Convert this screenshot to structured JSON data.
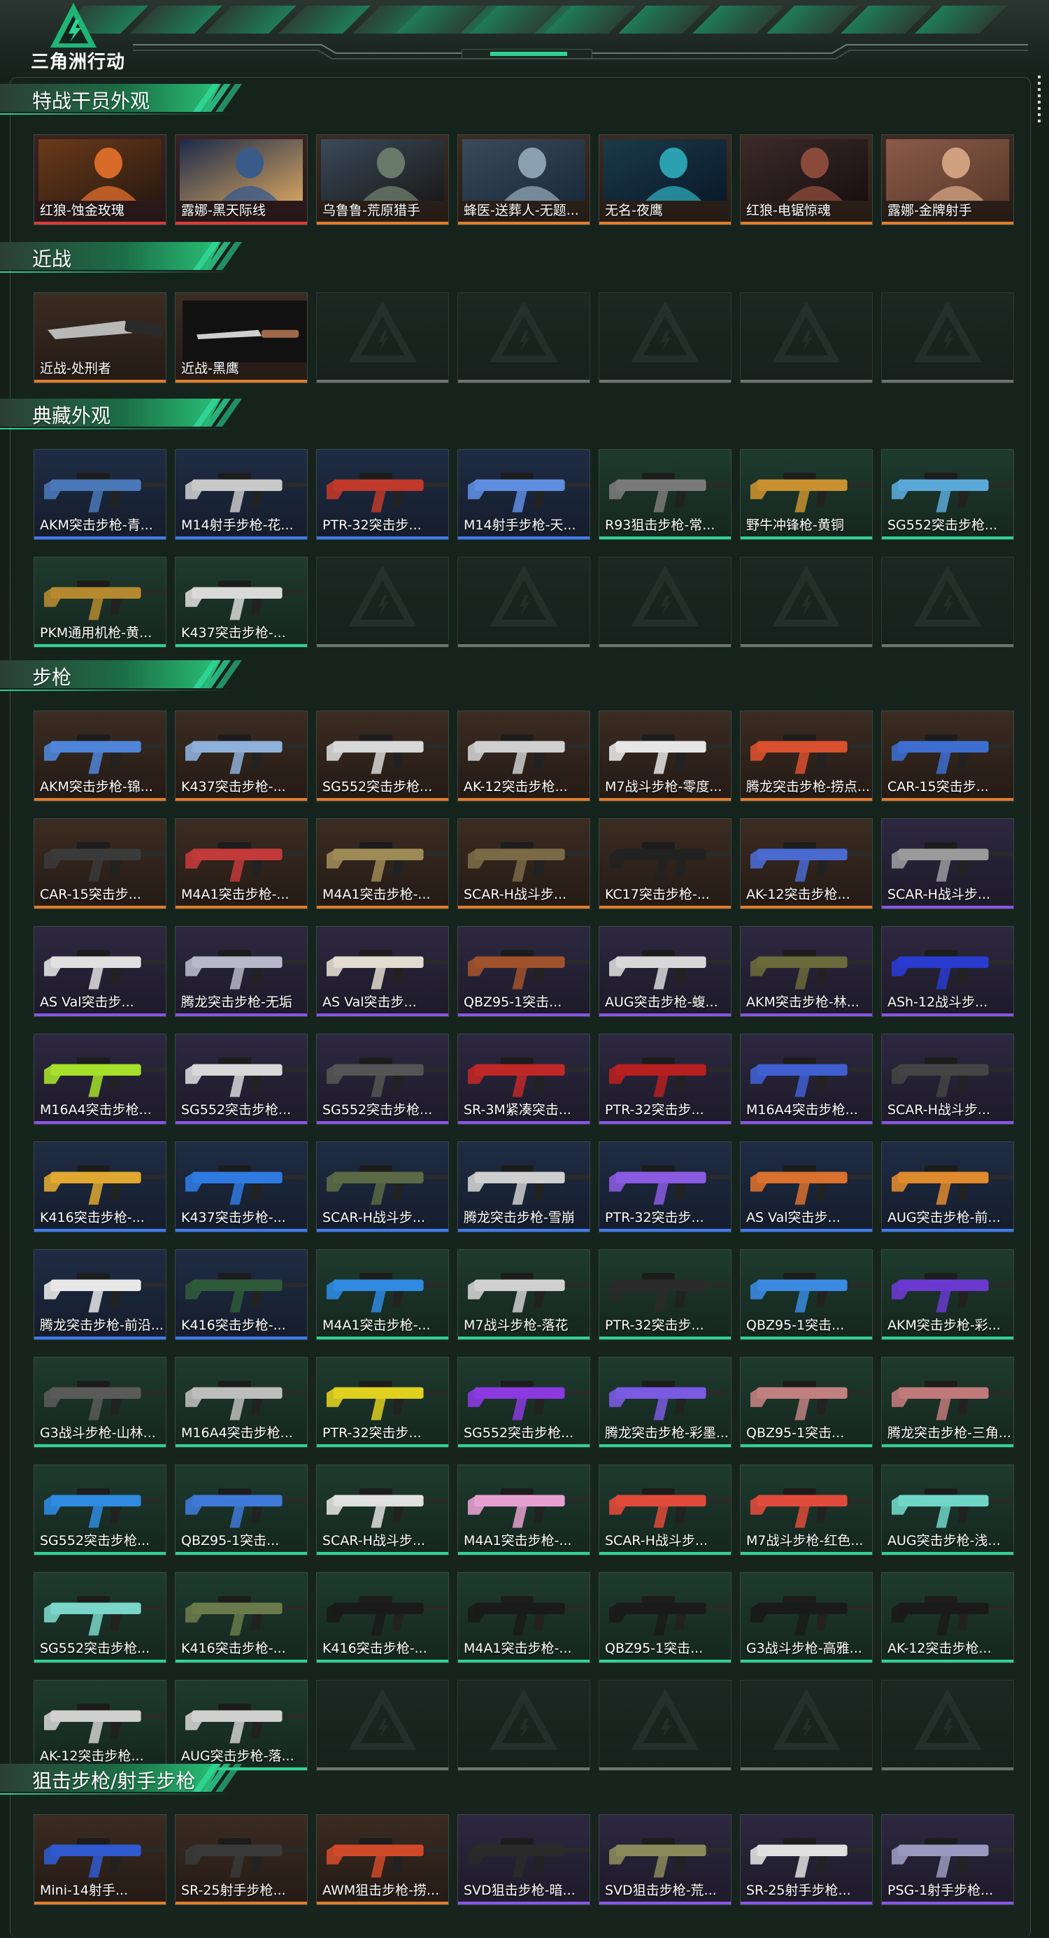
{
  "header": {
    "logo_text": "三角洲行动",
    "colors": {
      "accent": "#2fd394",
      "background": "#152019"
    }
  },
  "sections": [
    {
      "title": "特战干员外观",
      "items": [
        {
          "label": "红狼-蚀金玫瑰",
          "rarity": "red",
          "icon": "operator-portrait"
        },
        {
          "label": "露娜-黑天际线",
          "rarity": "red",
          "icon": "operator-portrait"
        },
        {
          "label": "乌鲁鲁-荒原猎手",
          "rarity": "orange",
          "icon": "operator-portrait"
        },
        {
          "label": "蜂医-送葬人-无题...",
          "rarity": "orange",
          "icon": "operator-portrait"
        },
        {
          "label": "无名-夜鹰",
          "rarity": "orange",
          "icon": "operator-portrait"
        },
        {
          "label": "红狼-电锯惊魂",
          "rarity": "orange",
          "icon": "operator-portrait"
        },
        {
          "label": "露娜-金牌射手",
          "rarity": "orange",
          "icon": "operator-portrait"
        }
      ]
    },
    {
      "title": "近战",
      "items": [
        {
          "label": "近战-处刑者",
          "rarity": "orange",
          "icon": "knife"
        },
        {
          "label": "近战-黑鹰",
          "rarity": "orange",
          "icon": "knife"
        },
        {
          "label": "",
          "rarity": "empty",
          "icon": "empty-slot"
        },
        {
          "label": "",
          "rarity": "empty",
          "icon": "empty-slot"
        },
        {
          "label": "",
          "rarity": "empty",
          "icon": "empty-slot"
        },
        {
          "label": "",
          "rarity": "empty",
          "icon": "empty-slot"
        },
        {
          "label": "",
          "rarity": "empty",
          "icon": "empty-slot"
        }
      ]
    },
    {
      "title": "典藏外观",
      "items": [
        {
          "label": "AKM突击步枪-青...",
          "rarity": "blue",
          "icon": "gun",
          "gun_color": "#4a78b8"
        },
        {
          "label": "M14射手步枪-花...",
          "rarity": "blue",
          "icon": "gun",
          "gun_color": "#c9c9c9"
        },
        {
          "label": "PTR-32突击步...",
          "rarity": "blue",
          "icon": "gun",
          "gun_color": "#c0392b"
        },
        {
          "label": "M14射手步枪-天...",
          "rarity": "blue",
          "icon": "gun",
          "gun_color": "#5f8de0"
        },
        {
          "label": "R93狙击步枪-常...",
          "rarity": "green",
          "icon": "gun",
          "gun_color": "#7a7a7a"
        },
        {
          "label": "野牛冲锋枪-黄铜",
          "rarity": "green",
          "icon": "gun",
          "gun_color": "#c8902e"
        },
        {
          "label": "SG552突击步枪...",
          "rarity": "green",
          "icon": "gun",
          "gun_color": "#5aa8d8"
        },
        {
          "label": "PKM通用机枪-黄...",
          "rarity": "green",
          "icon": "gun",
          "gun_color": "#b5892f"
        },
        {
          "label": "K437突击步枪-...",
          "rarity": "green",
          "icon": "gun",
          "gun_color": "#d9d9d9"
        },
        {
          "label": "",
          "rarity": "empty",
          "icon": "empty-slot"
        },
        {
          "label": "",
          "rarity": "empty",
          "icon": "empty-slot"
        },
        {
          "label": "",
          "rarity": "empty",
          "icon": "empty-slot"
        },
        {
          "label": "",
          "rarity": "empty",
          "icon": "empty-slot"
        },
        {
          "label": "",
          "rarity": "empty",
          "icon": "empty-slot"
        }
      ]
    },
    {
      "title": "步枪",
      "items": [
        {
          "label": "AKM突击步枪-锦...",
          "rarity": "orange",
          "icon": "gun",
          "gun_color": "#4f86d9"
        },
        {
          "label": "K437突击步枪-...",
          "rarity": "orange",
          "icon": "gun",
          "gun_color": "#8fb0d9"
        },
        {
          "label": "SG552突击步枪...",
          "rarity": "orange",
          "icon": "gun",
          "gun_color": "#d8d8d8"
        },
        {
          "label": "AK-12突击步枪...",
          "rarity": "orange",
          "icon": "gun",
          "gun_color": "#cfcfcf"
        },
        {
          "label": "M7战斗步枪-零度...",
          "rarity": "orange",
          "icon": "gun",
          "gun_color": "#e6e6e6"
        },
        {
          "label": "腾龙突击步枪-捞点...",
          "rarity": "orange",
          "icon": "gun",
          "gun_color": "#d9502e"
        },
        {
          "label": "CAR-15突击步...",
          "rarity": "orange",
          "icon": "gun",
          "gun_color": "#3d6ed0"
        },
        {
          "label": "CAR-15突击步...",
          "rarity": "orange",
          "icon": "gun",
          "gun_color": "#3a3a3a"
        },
        {
          "label": "M4A1突击步枪-...",
          "rarity": "orange",
          "icon": "gun",
          "gun_color": "#c23a3a"
        },
        {
          "label": "M4A1突击步枪-...",
          "rarity": "orange",
          "icon": "gun",
          "gun_color": "#9d8a55"
        },
        {
          "label": "SCAR-H战斗步...",
          "rarity": "orange",
          "icon": "gun",
          "gun_color": "#7a6a45"
        },
        {
          "label": "KC17突击步枪-...",
          "rarity": "orange",
          "icon": "gun",
          "gun_color": "#222222"
        },
        {
          "label": "AK-12突击步枪...",
          "rarity": "orange",
          "icon": "gun",
          "gun_color": "#4a6ad0"
        },
        {
          "label": "SCAR-H战斗步...",
          "rarity": "purple",
          "icon": "gun",
          "gun_color": "#9a9a9a"
        },
        {
          "label": "AS Val突击步...",
          "rarity": "purple",
          "icon": "gun",
          "gun_color": "#e0e0e0"
        },
        {
          "label": "腾龙突击步枪-无垢",
          "rarity": "purple",
          "icon": "gun",
          "gun_color": "#b8b8c8"
        },
        {
          "label": "AS Val突击步...",
          "rarity": "purple",
          "icon": "gun",
          "gun_color": "#e3dcd0"
        },
        {
          "label": "QBZ95-1突击...",
          "rarity": "purple",
          "icon": "gun",
          "gun_color": "#a0522d"
        },
        {
          "label": "AUG突击步枪-蝮...",
          "rarity": "purple",
          "icon": "gun",
          "gun_color": "#d8d8d8"
        },
        {
          "label": "AKM突击步枪-林...",
          "rarity": "purple",
          "icon": "gun",
          "gun_color": "#6a6a3a"
        },
        {
          "label": "ASh-12战斗步...",
          "rarity": "purple",
          "icon": "gun",
          "gun_color": "#2a3bd0"
        },
        {
          "label": "M16A4突击步枪...",
          "rarity": "purple",
          "icon": "gun",
          "gun_color": "#a6e02a"
        },
        {
          "label": "SG552突击步枪...",
          "rarity": "purple",
          "icon": "gun",
          "gun_color": "#d8d8d8"
        },
        {
          "label": "SG552突击步枪...",
          "rarity": "purple",
          "icon": "gun",
          "gun_color": "#555555"
        },
        {
          "label": "SR-3M紧凑突击...",
          "rarity": "purple",
          "icon": "gun",
          "gun_color": "#c02828"
        },
        {
          "label": "PTR-32突击步...",
          "rarity": "purple",
          "icon": "gun",
          "gun_color": "#b52020"
        },
        {
          "label": "M16A4突击步枪...",
          "rarity": "purple",
          "icon": "gun",
          "gun_color": "#3f5fd0"
        },
        {
          "label": "SCAR-H战斗步...",
          "rarity": "purple",
          "icon": "gun",
          "gun_color": "#444444"
        },
        {
          "label": "K416突击步枪-...",
          "rarity": "blue",
          "icon": "gun",
          "gun_color": "#e0a830"
        },
        {
          "label": "K437突击步枪-...",
          "rarity": "blue",
          "icon": "gun",
          "gun_color": "#2f7ae0"
        },
        {
          "label": "SCAR-H战斗步...",
          "rarity": "blue",
          "icon": "gun",
          "gun_color": "#5a6a45"
        },
        {
          "label": "腾龙突击步枪-雪崩",
          "rarity": "blue",
          "icon": "gun",
          "gun_color": "#cfcfcf"
        },
        {
          "label": "PTR-32突击步...",
          "rarity": "blue",
          "icon": "gun",
          "gun_color": "#8a5ae0"
        },
        {
          "label": "AS Val突击步...",
          "rarity": "blue",
          "icon": "gun",
          "gun_color": "#d9702e"
        },
        {
          "label": "AUG突击步枪-前...",
          "rarity": "blue",
          "icon": "gun",
          "gun_color": "#e08a2e"
        },
        {
          "label": "腾龙突击步枪-前沿...",
          "rarity": "blue",
          "icon": "gun",
          "gun_color": "#e8e8e8"
        },
        {
          "label": "K416突击步枪-...",
          "rarity": "blue",
          "icon": "gun",
          "gun_color": "#2e5a3a"
        },
        {
          "label": "M4A1突击步枪-...",
          "rarity": "green",
          "icon": "gun",
          "gun_color": "#2f8ae0"
        },
        {
          "label": "M7战斗步枪-落花",
          "rarity": "green",
          "icon": "gun",
          "gun_color": "#d0d0d0"
        },
        {
          "label": "PTR-32突击步...",
          "rarity": "green",
          "icon": "gun",
          "gun_color": "#2a2a2a"
        },
        {
          "label": "QBZ95-1突击...",
          "rarity": "green",
          "icon": "gun",
          "gun_color": "#3a8ae0"
        },
        {
          "label": "AKM突击步枪-彩...",
          "rarity": "green",
          "icon": "gun",
          "gun_color": "#6a3ad0"
        },
        {
          "label": "G3战斗步枪-山林...",
          "rarity": "green",
          "icon": "gun",
          "gun_color": "#5a5a5a"
        },
        {
          "label": "M16A4突击步枪...",
          "rarity": "green",
          "icon": "gun",
          "gun_color": "#bdbdbd"
        },
        {
          "label": "PTR-32突击步...",
          "rarity": "green",
          "icon": "gun",
          "gun_color": "#e0d020"
        },
        {
          "label": "SG552突击步枪...",
          "rarity": "green",
          "icon": "gun",
          "gun_color": "#8a3ae0"
        },
        {
          "label": "腾龙突击步枪-彩墨...",
          "rarity": "green",
          "icon": "gun",
          "gun_color": "#7a5ae0"
        },
        {
          "label": "QBZ95-1突击...",
          "rarity": "green",
          "icon": "gun",
          "gun_color": "#c08080"
        },
        {
          "label": "腾龙突击步枪-三角...",
          "rarity": "green",
          "icon": "gun",
          "gun_color": "#c07a7a"
        },
        {
          "label": "SG552突击步枪...",
          "rarity": "green",
          "icon": "gun",
          "gun_color": "#2f8ae0"
        },
        {
          "label": "QBZ95-1突击...",
          "rarity": "green",
          "icon": "gun",
          "gun_color": "#3f7ad8"
        },
        {
          "label": "SCAR-H战斗步...",
          "rarity": "green",
          "icon": "gun",
          "gun_color": "#e0e0e0"
        },
        {
          "label": "M4A1突击步枪-...",
          "rarity": "green",
          "icon": "gun",
          "gun_color": "#e6a0d0"
        },
        {
          "label": "SCAR-H战斗步...",
          "rarity": "green",
          "icon": "gun",
          "gun_color": "#e04a3a"
        },
        {
          "label": "M7战斗步枪-红色...",
          "rarity": "green",
          "icon": "gun",
          "gun_color": "#e04a3a"
        },
        {
          "label": "AUG突击步枪-浅...",
          "rarity": "green",
          "icon": "gun",
          "gun_color": "#6fd6c8"
        },
        {
          "label": "SG552突击步枪...",
          "rarity": "green",
          "icon": "gun",
          "gun_color": "#7ad6c8"
        },
        {
          "label": "K416突击步枪-...",
          "rarity": "green",
          "icon": "gun",
          "gun_color": "#6a7a4a"
        },
        {
          "label": "K416突击步枪-...",
          "rarity": "green",
          "icon": "gun",
          "gun_color": "#1a1a1a"
        },
        {
          "label": "M4A1突击步枪-...",
          "rarity": "green",
          "icon": "gun",
          "gun_color": "#1a1a1a"
        },
        {
          "label": "QBZ95-1突击...",
          "rarity": "green",
          "icon": "gun",
          "gun_color": "#1a1a1a"
        },
        {
          "label": "G3战斗步枪-高雅...",
          "rarity": "green",
          "icon": "gun",
          "gun_color": "#1a1a1a"
        },
        {
          "label": "AK-12突击步枪...",
          "rarity": "green",
          "icon": "gun",
          "gun_color": "#1a1a1a"
        },
        {
          "label": "AK-12突击步枪...",
          "rarity": "green",
          "icon": "gun",
          "gun_color": "#d0d0d0"
        },
        {
          "label": "AUG突击步枪-落...",
          "rarity": "green",
          "icon": "gun",
          "gun_color": "#d0d0d0"
        },
        {
          "label": "",
          "rarity": "empty",
          "icon": "empty-slot"
        },
        {
          "label": "",
          "rarity": "empty",
          "icon": "empty-slot"
        },
        {
          "label": "",
          "rarity": "empty",
          "icon": "empty-slot"
        },
        {
          "label": "",
          "rarity": "empty",
          "icon": "empty-slot"
        },
        {
          "label": "",
          "rarity": "empty",
          "icon": "empty-slot"
        }
      ]
    },
    {
      "title": "狙击步枪/射手步枪",
      "items": [
        {
          "label": "Mini-14射手...",
          "rarity": "orange",
          "icon": "gun",
          "gun_color": "#2f5ad0"
        },
        {
          "label": "SR-25射手步枪...",
          "rarity": "orange",
          "icon": "gun",
          "gun_color": "#3a3a3a"
        },
        {
          "label": "AWM狙击步枪-捞...",
          "rarity": "orange",
          "icon": "gun",
          "gun_color": "#d04a2a"
        },
        {
          "label": "SVD狙击步枪-暗...",
          "rarity": "purple",
          "icon": "gun",
          "gun_color": "#2a2a2a"
        },
        {
          "label": "SVD狙击步枪-荒...",
          "rarity": "purple",
          "icon": "gun",
          "gun_color": "#8a8a5a"
        },
        {
          "label": "SR-25射手步枪...",
          "rarity": "purple",
          "icon": "gun",
          "gun_color": "#e0e0e0"
        },
        {
          "label": "PSG-1射手步枪...",
          "rarity": "purple",
          "icon": "gun",
          "gun_color": "#9a9ac0"
        }
      ]
    }
  ]
}
